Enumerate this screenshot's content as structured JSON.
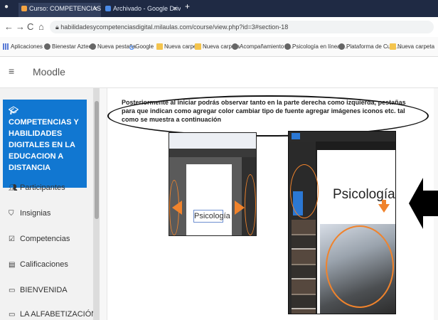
{
  "browser": {
    "tabs": [
      {
        "label": "Curso: COMPETENCIAS Y HABIL",
        "close": "×"
      },
      {
        "label": "Archivado - Google Drive",
        "close": "×"
      }
    ],
    "new_tab": "+",
    "nav": {
      "back": "←",
      "forward": "→",
      "reload": "C",
      "home": "⌂"
    },
    "url": "habilidadesycompetenciasdigital.milaulas.com/course/view.php?id=3#section-18",
    "bookmarks": [
      {
        "label": "Aplicaciones",
        "icon": "apps-icon"
      },
      {
        "label": "Bienestar Azteca",
        "icon": "globe-icon"
      },
      {
        "label": "Nueva pestaña",
        "icon": "globe-icon"
      },
      {
        "label": "Google",
        "icon": "google-icon"
      },
      {
        "label": "Nueva carpeta",
        "icon": "folder-icon"
      },
      {
        "label": "Nueva carpeta",
        "icon": "folder-icon"
      },
      {
        "label": "Acompañamiento P...",
        "icon": "globe-icon"
      },
      {
        "label": "Psicología en línea |...",
        "icon": "globe-icon"
      },
      {
        "label": "Plataforma de Curs...",
        "icon": "globe-icon"
      },
      {
        "label": "Nueva carpeta",
        "icon": "folder-icon"
      }
    ]
  },
  "moodle": {
    "menu_icon": "≡",
    "brand": "Moodle",
    "sidebar": {
      "course_icon": "graduation-cap-icon",
      "course_title": "COMPETENCIAS Y HABILIDADES DIGITALES EN LA EDUCACION A DISTANCIA",
      "items": [
        {
          "label": "Participantes",
          "icon": "users-icon"
        },
        {
          "label": "Insignias",
          "icon": "shield-icon"
        },
        {
          "label": "Competencias",
          "icon": "checkbox-icon"
        },
        {
          "label": "Calificaciones",
          "icon": "table-icon"
        },
        {
          "label": "BIENVENIDA",
          "icon": "folder-icon"
        },
        {
          "label": "LA ALFABETIZACIÓN",
          "icon": "folder-icon"
        }
      ]
    },
    "content": {
      "instruction": "Posteriormente al iniciar podrás observar tanto en la parte derecha como izquierda, pestañas para que indican como agregar color cambiar tipo de fuente agregar imágenes iconos etc. tal como se muestra a continuación",
      "left_screenshot_word": "Psicología",
      "right_screenshot_word": "Psicología"
    }
  },
  "colors": {
    "accent": "#1177d1",
    "annotation": "#f0832c"
  }
}
